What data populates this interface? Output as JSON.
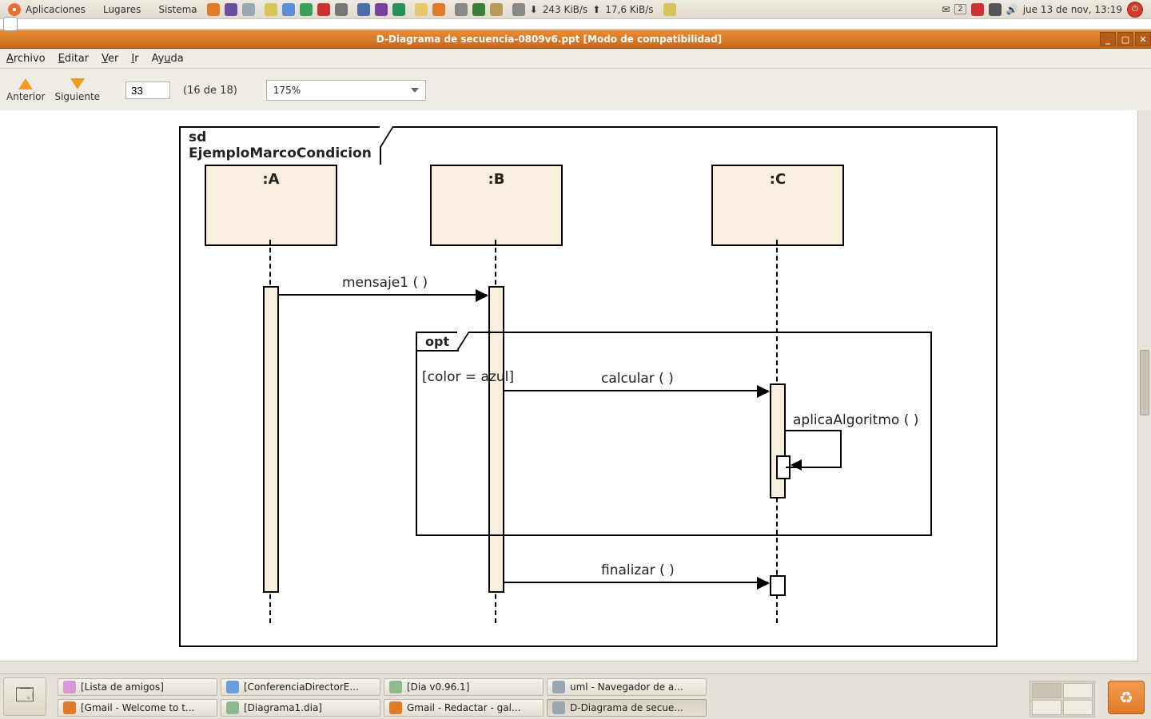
{
  "panel": {
    "menus": [
      "Aplicaciones",
      "Lugares",
      "Sistema"
    ],
    "net_down": "243 KiB/s",
    "net_up": "17,6 KiB/s",
    "tray_badge": "2",
    "clock": "jue 13 de nov, 13:19"
  },
  "window": {
    "title": "D-Diagrama de secuencia-0809v6.ppt  [Modo de compatibilidad]"
  },
  "menubar": {
    "file": "Archivo",
    "file_u": "A",
    "edit": "Editar",
    "edit_u": "E",
    "view": "Ver",
    "view_u": "V",
    "go": "Ir",
    "go_u": "I",
    "help": "Ayuda",
    "help_u": "u"
  },
  "toolbar": {
    "prev": "Anterior",
    "next": "Siguiente",
    "page_value": "33",
    "page_counter": "(16 de 18)",
    "zoom": "175%"
  },
  "diagram": {
    "frame_title": "sd  EjemploMarcoCondicion",
    "lifelines": {
      "A": ":A",
      "B": ":B",
      "C": ":C"
    },
    "messages": {
      "m1": "mensaje1 ( )",
      "calc": "calcular ( )",
      "algo": "aplicaAlgoritmo ( )",
      "fin": "finalizar ( )"
    },
    "opt_label": "opt",
    "guard": "[color = azul]"
  },
  "taskbar": {
    "row1": [
      "[Lista de amigos]",
      "[ConferenciaDirectorE...",
      "[Dia v0.96.1]",
      "uml - Navegador de a..."
    ],
    "row2": [
      "[Gmail - Welcome to t...",
      "[Diagrama1.dia]",
      "Gmail - Redactar - gal...",
      "D-Diagrama de secue..."
    ]
  }
}
